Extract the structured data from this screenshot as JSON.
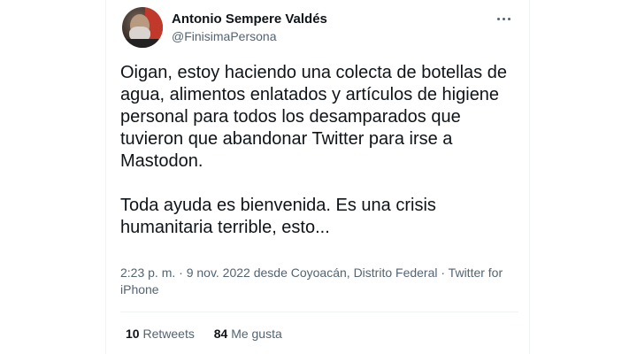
{
  "tweet": {
    "author_name": "Antonio Sempere Valdés",
    "author_handle": "@FinisimaPersona",
    "more_icon": "more-icon",
    "paragraph1": "Oigan, estoy haciendo una colecta de botellas de agua, alimentos enlatados y artículos de higiene personal para todos los desamparados que tuvieron que abandonar Twitter para irse a Mastodon.",
    "paragraph2": "Toda ayuda es bienvenida. Es una crisis humanitaria terrible, esto...",
    "meta": "2:23 p. m. · 9 nov. 2022 desde Coyoacán, Distrito Federal · Twitter for iPhone",
    "retweets_count": "10",
    "retweets_label": "Retweets",
    "likes_count": "84",
    "likes_label": "Me gusta"
  }
}
